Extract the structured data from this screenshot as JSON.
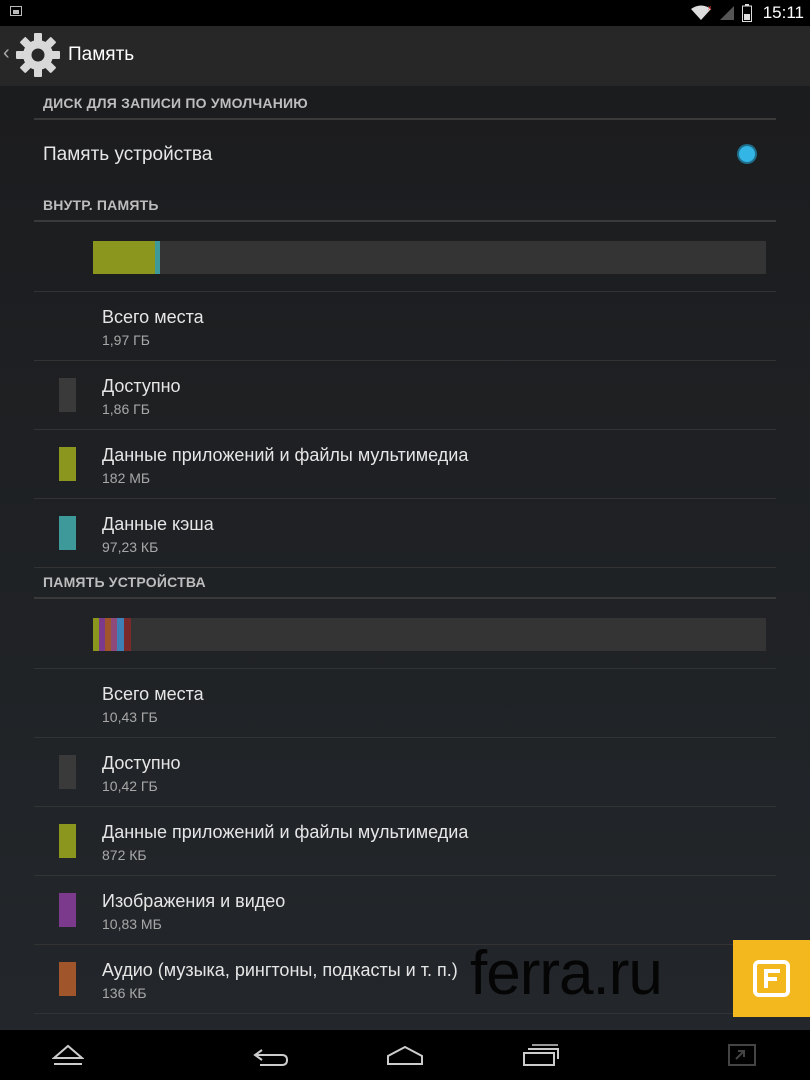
{
  "status_bar": {
    "time": "15:11"
  },
  "action_bar": {
    "title": "Память"
  },
  "sections": {
    "default_disk": {
      "header": "ДИСК ДЛЯ ЗАПИСИ ПО УМОЛЧАНИЮ",
      "option_label": "Память устройства"
    },
    "internal": {
      "header": "ВНУТР. ПАМЯТЬ",
      "usage_fractions": {
        "apps": 0.092,
        "cache": 0.008
      },
      "items": [
        {
          "title": "Всего места",
          "value": "1,97 ГБ"
        },
        {
          "title": "Доступно",
          "value": "1,86 ГБ"
        },
        {
          "title": "Данные приложений и файлы мультимедиа",
          "value": "182 МБ"
        },
        {
          "title": "Данные кэша",
          "value": "97,23 КБ"
        }
      ]
    },
    "device": {
      "header": "ПАМЯТЬ УСТРОЙСТВА",
      "items": [
        {
          "title": "Всего места",
          "value": "10,43 ГБ"
        },
        {
          "title": "Доступно",
          "value": "10,42 ГБ"
        },
        {
          "title": "Данные приложений и файлы мультимедиа",
          "value": "872 КБ"
        },
        {
          "title": "Изображения и видео",
          "value": "10,83 МБ"
        },
        {
          "title": "Аудио (музыка, рингтоны, подкасты и т. п.)",
          "value": "136 КБ"
        }
      ]
    }
  },
  "colors": {
    "available": "#3a3a3a",
    "apps": "#8a961e",
    "cache": "#3e9a9a",
    "images": "#7b3a8c",
    "audio": "#a0562a",
    "accent": "#33b5e5",
    "watermark_logo": "#f4b81f"
  },
  "watermark": {
    "text": "ferra.ru"
  }
}
